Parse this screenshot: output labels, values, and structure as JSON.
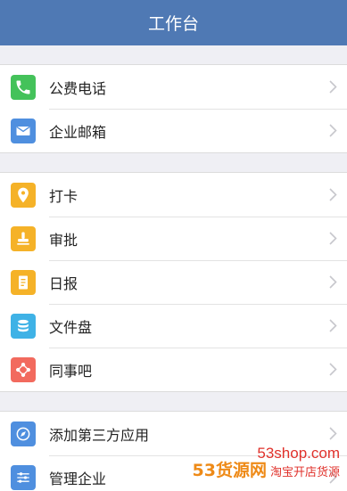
{
  "header": {
    "title": "工作台"
  },
  "groups": [
    {
      "items": [
        {
          "label": "公费电话",
          "icon": "phone-icon",
          "color": "#44c25a"
        },
        {
          "label": "企业邮箱",
          "icon": "mail-icon",
          "color": "#4f8fdf"
        }
      ]
    },
    {
      "items": [
        {
          "label": "打卡",
          "icon": "location-pin-icon",
          "color": "#f5b228"
        },
        {
          "label": "审批",
          "icon": "stamp-icon",
          "color": "#f5b228"
        },
        {
          "label": "日报",
          "icon": "report-icon",
          "color": "#f5b228"
        },
        {
          "label": "文件盘",
          "icon": "database-icon",
          "color": "#3fb2e6"
        },
        {
          "label": "同事吧",
          "icon": "network-icon",
          "color": "#f26a5e"
        }
      ]
    },
    {
      "items": [
        {
          "label": "添加第三方应用",
          "icon": "compass-icon",
          "color": "#4f8fdf"
        },
        {
          "label": "管理企业",
          "icon": "sliders-icon",
          "color": "#4f8fdf"
        }
      ]
    }
  ],
  "watermark": {
    "site": "53shop.com",
    "brand": "53货源网",
    "tagline": "淘宝开店货源"
  }
}
